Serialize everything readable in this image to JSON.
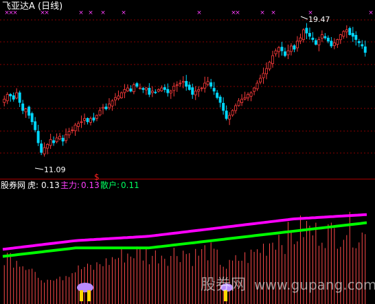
{
  "colors": {
    "background": "#000000",
    "up_candle": "#ff3c3c",
    "down_candle": "#00d8ff",
    "grid": "#8a0000",
    "divider": "#b40000",
    "signal_marker": "#ff40ff",
    "main_line": "#ff00ff",
    "retail_line": "#00ff00",
    "histogram": "#ff4a4a",
    "title": "#ffffff",
    "label_tiger": "#ffffff",
    "label_main": "#ff40ff",
    "label_retail": "#00ff60",
    "dollar": "#ff2020"
  },
  "header": {
    "stock_title": "飞亚达A (日线)"
  },
  "indicator_labels": {
    "source": "股券网",
    "tiger_label": "虎:",
    "tiger_value": "0.13",
    "main_label": "主力:",
    "main_value": "0.13",
    "retail_label": "散户:",
    "retail_value": "0.11"
  },
  "annotations": {
    "high_label": "19.47",
    "low_label": "11.09",
    "dollar_sign": "$"
  },
  "watermark": {
    "cn": "股券网",
    "url": "www.gupang.com"
  },
  "chart_data": {
    "type": "candlestick",
    "price_high": 19.47,
    "price_low": 11.09,
    "ylim": [
      10.5,
      20.2
    ],
    "closes": [
      14.9,
      15.2,
      15.1,
      14.9,
      15.3,
      14.7,
      14.2,
      14.3,
      13.9,
      13.5,
      13.0,
      12.2,
      11.6,
      11.9,
      12.1,
      12.4,
      12.2,
      12.5,
      12.6,
      12.3,
      12.7,
      12.9,
      13.0,
      13.3,
      13.4,
      13.5,
      13.7,
      13.5,
      13.7,
      13.6,
      13.9,
      14.2,
      14.4,
      14.3,
      14.6,
      14.8,
      15.0,
      15.1,
      15.3,
      15.5,
      15.6,
      15.4,
      15.8,
      15.7,
      15.6,
      15.5,
      15.6,
      15.2,
      15.4,
      15.3,
      15.5,
      15.6,
      15.5,
      15.3,
      15.4,
      15.7,
      15.8,
      15.9,
      16.0,
      15.7,
      15.5,
      15.2,
      15.4,
      15.5,
      15.6,
      15.9,
      16.0,
      15.7,
      15.4,
      15.0,
      14.7,
      14.2,
      13.7,
      13.9,
      14.2,
      14.5,
      14.8,
      14.9,
      15.0,
      15.2,
      15.3,
      15.6,
      15.9,
      16.2,
      16.5,
      16.8,
      17.2,
      17.6,
      17.9,
      18.1,
      17.9,
      17.6,
      17.9,
      18.2,
      18.0,
      18.5,
      18.7,
      19.2,
      19.0,
      18.8,
      18.6,
      18.3,
      18.6,
      18.9,
      18.7,
      18.5,
      18.2,
      18.4,
      18.6,
      18.9,
      19.1,
      19.2,
      18.9,
      18.8,
      18.6,
      18.4,
      18.2,
      17.8
    ],
    "main_force_line": [
      0.05,
      0.07,
      0.08,
      0.1,
      0.12,
      0.13
    ],
    "retail_line": [
      0.03,
      0.05,
      0.05,
      0.07,
      0.09,
      0.11
    ],
    "indicator_values": {
      "tiger": 0.13,
      "main_force": 0.13,
      "retail": 0.11
    },
    "grid": true
  }
}
